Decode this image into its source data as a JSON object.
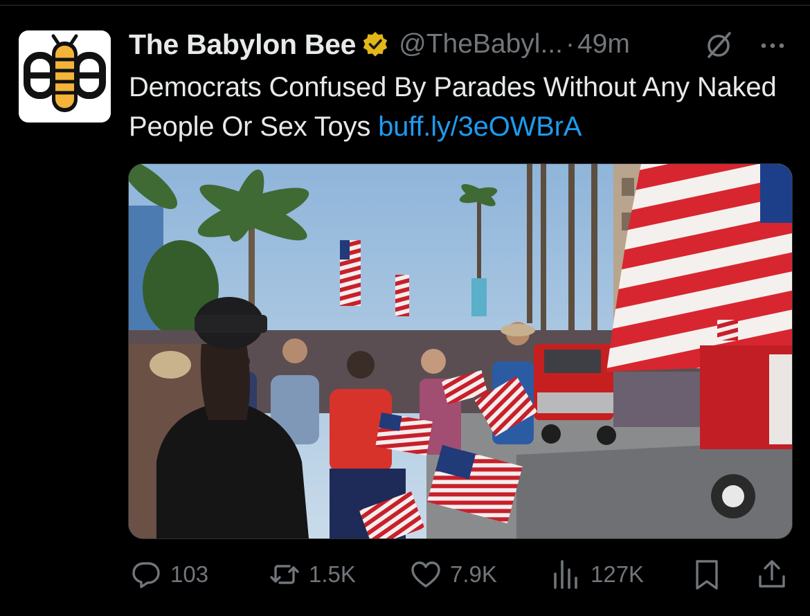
{
  "tweet": {
    "display_name": "The Babylon Bee",
    "handle": "@TheBabyl...",
    "separator": "·",
    "time": "49m",
    "text": "Democrats Confused By Parades Without Any Naked People Or Sex Toys ",
    "link": "buff.ly/3eOWBrA"
  },
  "metrics": {
    "replies": "103",
    "reposts": "1.5K",
    "likes": "7.9K",
    "views": "127K"
  },
  "icons": {
    "avatar": "babylon-bee-logo",
    "verified": "gold-verified-badge",
    "grok": "grok-icon",
    "more": "more-icon",
    "reply": "reply-icon",
    "repost": "repost-icon",
    "like": "like-icon",
    "views": "views-icon",
    "bookmark": "bookmark-icon",
    "share": "share-icon"
  },
  "colors": {
    "background": "#000000",
    "text": "#e7e9ea",
    "secondary": "#71767b",
    "link": "#1d9bf0",
    "verified": "#e2b719"
  }
}
